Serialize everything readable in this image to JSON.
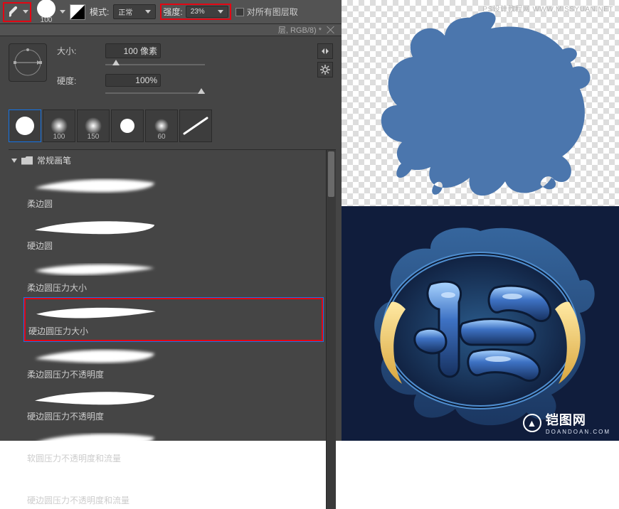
{
  "toolbar": {
    "brush_size_preview_label": "100",
    "mode_label": "模式:",
    "mode_value": "正常",
    "strength_label": "强度:",
    "strength_value": "23%",
    "sample_all_label": "对所有图层取"
  },
  "tab_title": "层, RGB/8) *",
  "settings": {
    "size_label": "大小:",
    "size_value": "100 像素",
    "hardness_label": "硬度:",
    "hardness_value": "100%"
  },
  "thumbs": [
    {
      "label": ""
    },
    {
      "label": "100"
    },
    {
      "label": "150"
    },
    {
      "label": ""
    },
    {
      "label": "60"
    },
    {
      "label": ""
    }
  ],
  "folder_name": "常规画笔",
  "brushes": [
    {
      "name": "柔边圆",
      "soft": true,
      "taper": false,
      "highlight": false
    },
    {
      "name": "硬边圆",
      "soft": false,
      "taper": false,
      "highlight": false
    },
    {
      "name": "柔边圆压力大小",
      "soft": true,
      "taper": true,
      "highlight": false
    },
    {
      "name": "硬边圆压力大小",
      "soft": false,
      "taper": true,
      "highlight": true
    },
    {
      "name": "柔边圆压力不透明度",
      "soft": true,
      "taper": false,
      "highlight": false
    },
    {
      "name": "硬边圆压力不透明度",
      "soft": false,
      "taper": false,
      "highlight": false
    },
    {
      "name": "软圆压力不透明度和流量",
      "soft": true,
      "taper": false,
      "highlight": false
    },
    {
      "name": "硬边圆压力不透明度和流量",
      "soft": false,
      "taper": false,
      "highlight": false
    }
  ],
  "attribution": {
    "top": "PS设计教程网   WWW.MISSYUAN.NET",
    "bottom_text": "铠图网",
    "bottom_url": "DOANDOAN.COM"
  },
  "flame_color": "#4b76ad"
}
